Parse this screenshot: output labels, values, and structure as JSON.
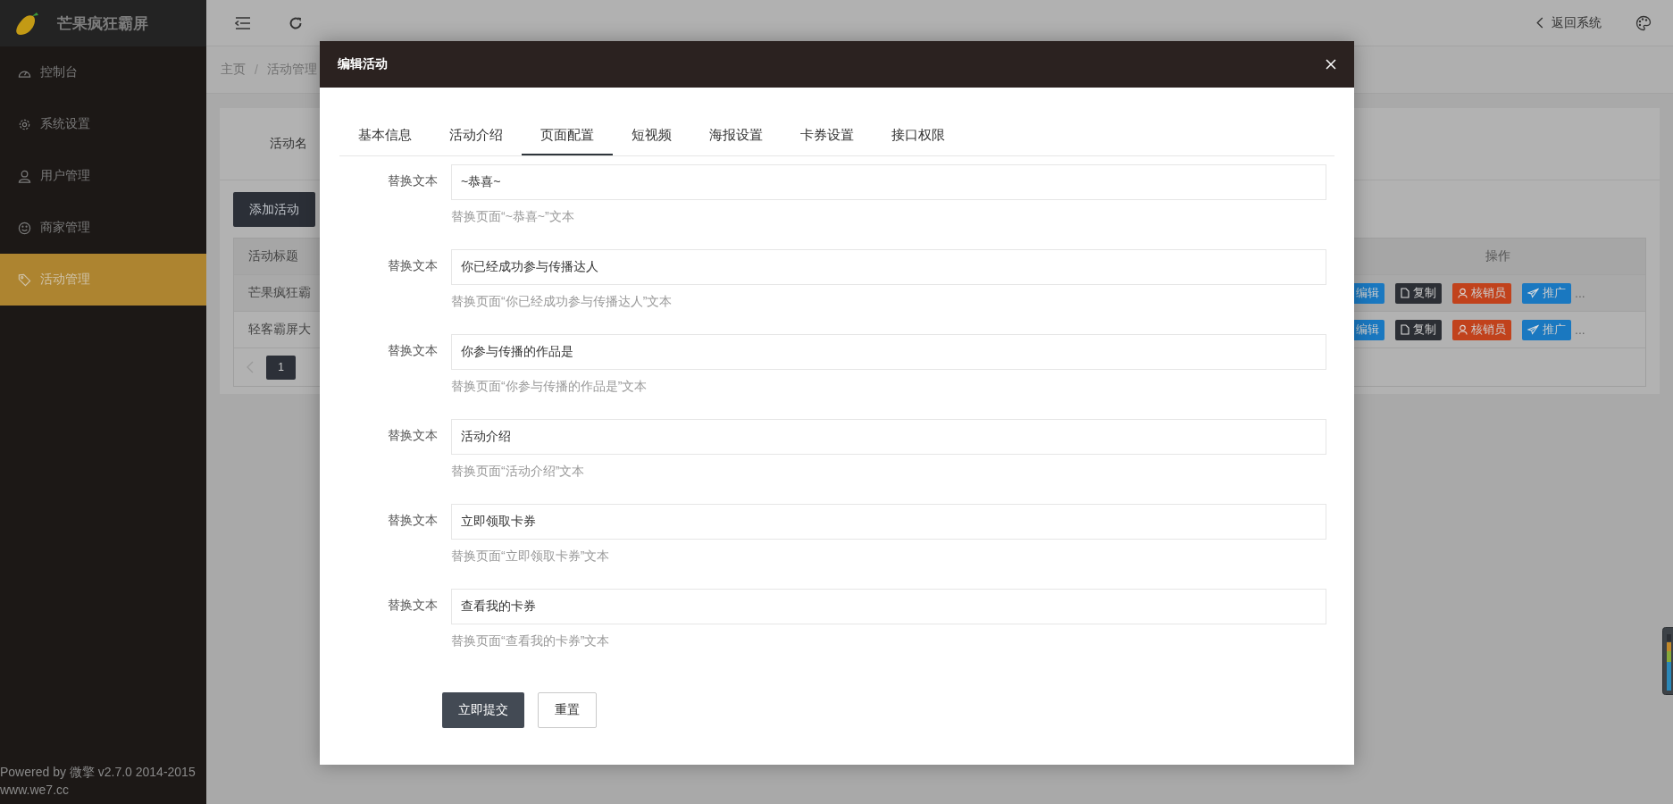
{
  "sidebar": {
    "logo_text": "芒果疯狂霸屏",
    "items": [
      {
        "label": "控制台",
        "selected": false
      },
      {
        "label": "系统设置",
        "selected": false
      },
      {
        "label": "用户管理",
        "selected": false
      },
      {
        "label": "商家管理",
        "selected": false
      },
      {
        "label": "活动管理",
        "selected": true
      }
    ],
    "footer": [
      "Powered by 微擎 v2.7.0 2014-2015",
      "www.we7.cc"
    ]
  },
  "header": {
    "return_label": "返回系统"
  },
  "breadcrumb": {
    "items": [
      "主页",
      "活动管理"
    ],
    "separator": "/"
  },
  "search": {
    "label": "活动名"
  },
  "add_button": "添加活动",
  "table": {
    "columns": [
      "活动标题",
      "操作"
    ],
    "rows": [
      {
        "title": "芒果疯狂霸",
        "actions": [
          {
            "label": "编辑",
            "kind": "edit"
          },
          {
            "label": "复制",
            "kind": "copy"
          },
          {
            "label": "核销员",
            "kind": "verifier"
          },
          {
            "label": "推广",
            "kind": "promote"
          }
        ],
        "more": "..."
      },
      {
        "title": "轻客霸屏大",
        "actions": [
          {
            "label": "编辑",
            "kind": "edit"
          },
          {
            "label": "复制",
            "kind": "copy"
          },
          {
            "label": "核销员",
            "kind": "verifier"
          },
          {
            "label": "推广",
            "kind": "promote"
          }
        ],
        "more": "..."
      }
    ]
  },
  "pagination": {
    "pages": [
      {
        "label": "1",
        "selected": true
      }
    ]
  },
  "modal": {
    "title": "编辑活动",
    "tabs": [
      {
        "label": "基本信息",
        "selected": false
      },
      {
        "label": "活动介绍",
        "selected": false
      },
      {
        "label": "页面配置",
        "selected": true
      },
      {
        "label": "短视频",
        "selected": false
      },
      {
        "label": "海报设置",
        "selected": false
      },
      {
        "label": "卡券设置",
        "selected": false
      },
      {
        "label": "接口权限",
        "selected": false
      }
    ],
    "fields": [
      {
        "label": "替换文本",
        "value": "~恭喜~",
        "hint": "替换页面“~恭喜~”文本"
      },
      {
        "label": "替换文本",
        "value": "你已经成功参与传播达人",
        "hint": "替换页面“你已经成功参与传播达人”文本"
      },
      {
        "label": "替换文本",
        "value": "你参与传播的作品是",
        "hint": "替换页面“你参与传播的作品是”文本"
      },
      {
        "label": "替换文本",
        "value": "活动介绍",
        "hint": "替换页面“活动介绍”文本"
      },
      {
        "label": "替换文本",
        "value": "立即领取卡券",
        "hint": "替换页面“立即领取卡券”文本"
      },
      {
        "label": "替换文本",
        "value": "查看我的卡券",
        "hint": "替换页面“查看我的卡券”文本"
      }
    ],
    "submit": "立即提交",
    "reset": "重置"
  }
}
